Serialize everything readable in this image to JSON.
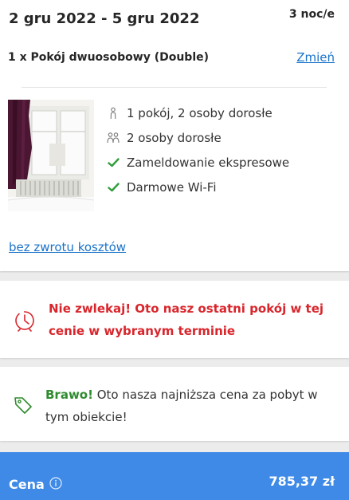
{
  "booking": {
    "dates": "2 gru 2022 - 5 gru 2022",
    "nights": "3 noc/e",
    "room_title": "1 x Pokój dwuosobowy (Double)",
    "change_label": "Zmień",
    "features": [
      {
        "icon": "person-icon",
        "label": "1 pokój, 2 osoby dorosłe"
      },
      {
        "icon": "group-icon",
        "label": "2 osoby dorosłe"
      },
      {
        "icon": "check-icon",
        "label": "Zameldowanie ekspresowe"
      },
      {
        "icon": "check-icon",
        "label": "Darmowe Wi-Fi"
      }
    ],
    "refund_label": "bez zwrotu kosztów"
  },
  "urgency": {
    "text": "Nie zwlekaj! Oto nasz ostatni pokój w tej cenie w wybranym terminie"
  },
  "price_message": {
    "highlight": "Brawo!",
    "text": " Oto nasza najniższa cena za pobyt w tym obiekcie!"
  },
  "price_bar": {
    "label": "Cena",
    "value": "785,37 zł"
  },
  "colors": {
    "link": "#1a73c9",
    "urgent": "#d8262c",
    "success": "#2e8b2e",
    "price_bar": "#3e8ae6"
  }
}
